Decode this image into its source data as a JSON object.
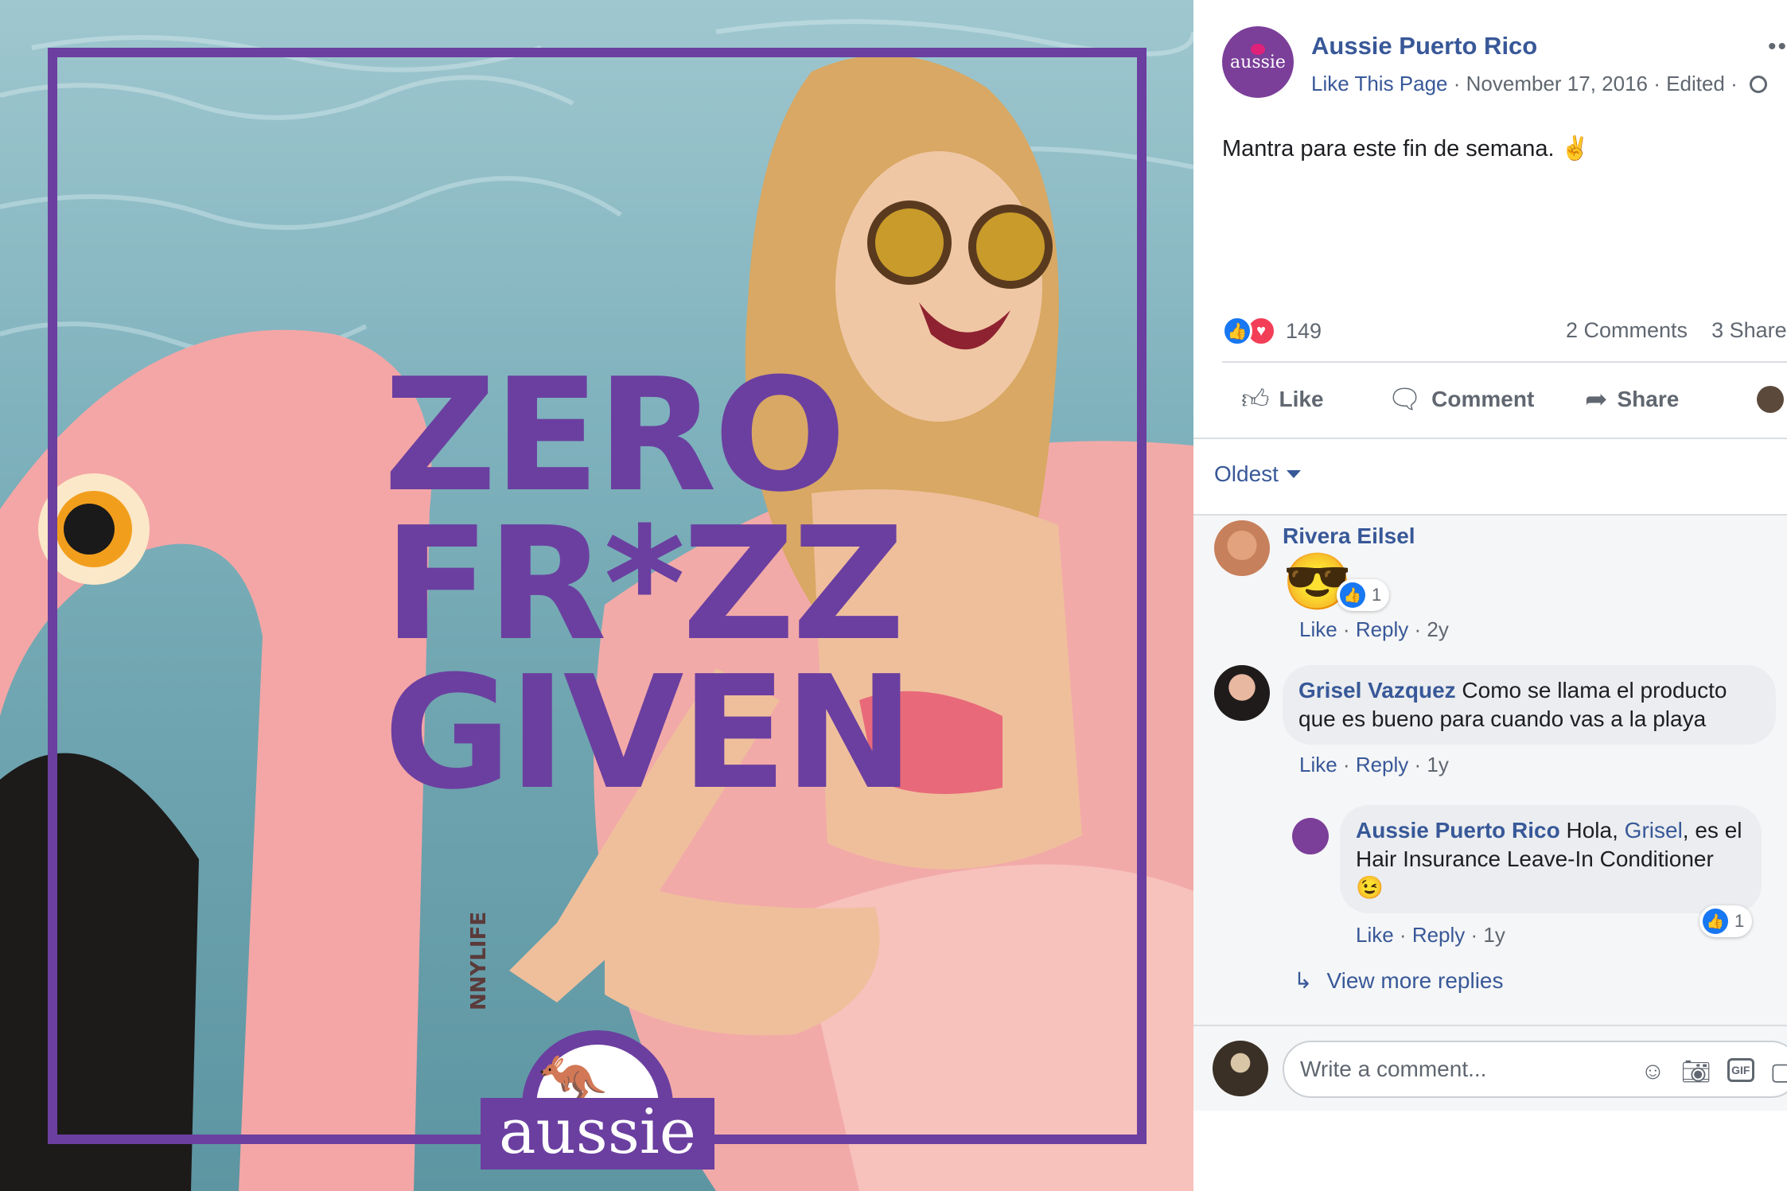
{
  "post": {
    "page_name": "Aussie Puerto Rico",
    "avatar_text": "aussie",
    "like_page": "Like This Page",
    "date": "November 17, 2016",
    "edited": "Edited",
    "text": "Mantra para este fin de semana. ✌",
    "reaction_count": "149",
    "comments_count": "2 Comments",
    "shares_count": "3 Share"
  },
  "image": {
    "headline": [
      "ZERO",
      "FR*ZZ",
      "GIVEN"
    ],
    "logo_text": "aussie",
    "float_text": "NNYLIFE"
  },
  "actions": {
    "like": "Like",
    "comment": "Comment",
    "share": "Share"
  },
  "sort": {
    "label": "Oldest"
  },
  "comments": [
    {
      "name": "Rivera Eilsel",
      "emoji": "😎",
      "reactions": "1",
      "like": "Like",
      "reply": "Reply",
      "time": "2y"
    },
    {
      "name": "Grisel Vazquez",
      "text": "Como se llama el producto que es bueno para cuando vas a la playa",
      "like": "Like",
      "reply": "Reply",
      "time": "1y"
    }
  ],
  "reply": {
    "name": "Aussie Puerto Rico",
    "text_before": "Hola,",
    "mention": "Grisel",
    "text_after": ", es el Hair Insurance Leave-In Conditioner 😉",
    "reactions": "1",
    "like": "Like",
    "reply": "Reply",
    "time": "1y"
  },
  "view_more": "View more replies",
  "composer": {
    "placeholder": "Write a comment...",
    "gif": "GIF"
  },
  "colors": {
    "brand_purple": "#6b3fa0",
    "link_blue": "#385898",
    "like_blue": "#1877f2",
    "love_red": "#f33e58"
  }
}
